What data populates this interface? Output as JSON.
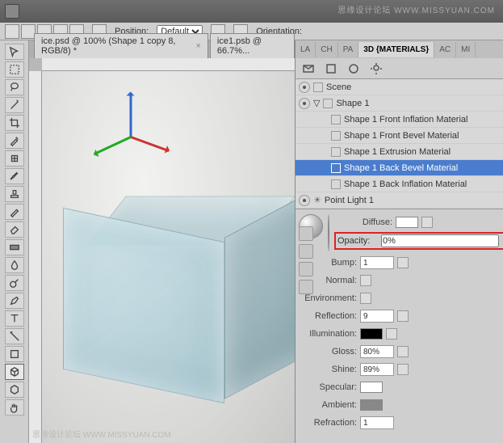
{
  "watermark_top": "思缘设计论坛  WWW.MISSYUAN.COM",
  "watermark_bottom": "思缘设计论坛  WWW.MISSYUAN.COM",
  "topbar": {
    "position_label": "Position:",
    "position_value": "Default",
    "orientation_label": "Orientation:"
  },
  "doc_tabs": [
    {
      "label": "ice.psd @ 100% (Shape 1 copy 8, RGB/8) *"
    },
    {
      "label": "ice1.psb @ 66.7%..."
    }
  ],
  "panel_tabs": [
    "LA",
    "CH",
    "PA",
    "3D {MATERIALS}",
    "AC",
    "MI"
  ],
  "active_panel_tab": 3,
  "scene": {
    "root": "Scene",
    "shape": "Shape 1",
    "materials": [
      "Shape 1 Front Inflation Material",
      "Shape 1 Front Bevel Material",
      "Shape 1 Extrusion Material",
      "Shape 1 Back Bevel Material",
      "Shape 1 Back Inflation Material"
    ],
    "selected_material_index": 3,
    "light": "Point Light 1"
  },
  "props": {
    "diffuse_label": "Diffuse:",
    "opacity_label": "Opacity:",
    "opacity_value": "0%",
    "bump_label": "Bump:",
    "bump_value": "1",
    "normal_label": "Normal:",
    "environment_label": "Environment:",
    "reflection_label": "Reflection:",
    "reflection_value": "9",
    "illumination_label": "Illumination:",
    "gloss_label": "Gloss:",
    "gloss_value": "80%",
    "shine_label": "Shine:",
    "shine_value": "89%",
    "specular_label": "Specular:",
    "ambient_label": "Ambient:",
    "refraction_label": "Refraction:",
    "refraction_value": "1"
  }
}
